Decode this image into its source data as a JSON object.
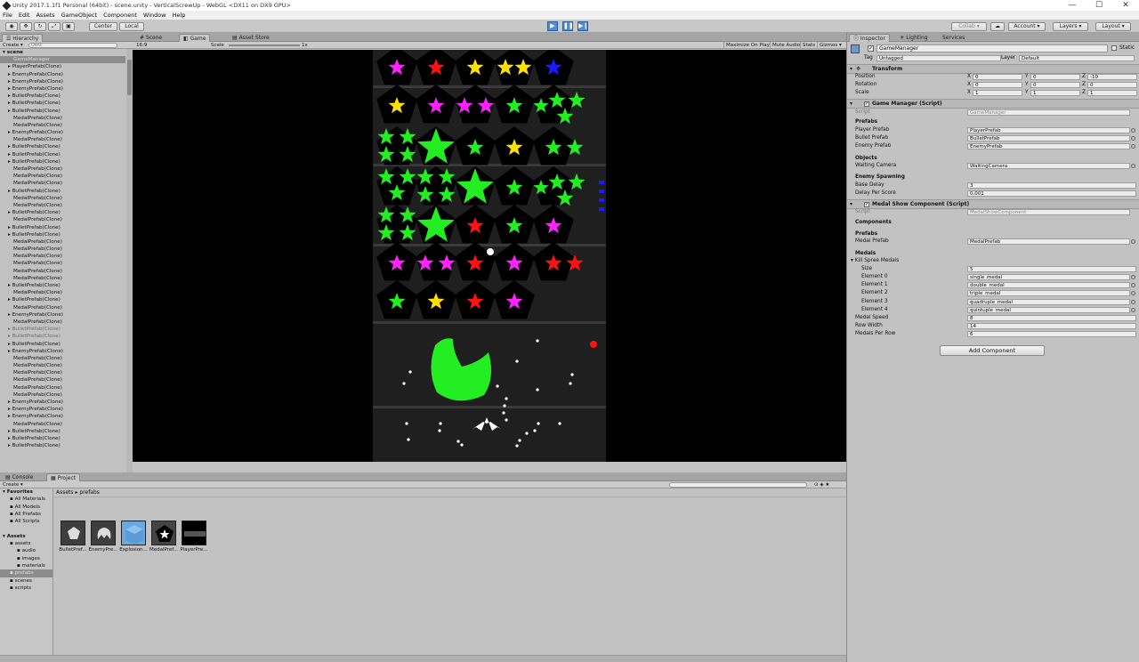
{
  "window": {
    "title": "Unity 2017.1.1f1 Personal (64bit) - scene.unity - VerticalScrewUp - WebGL <DX11 on DX9 GPU>",
    "minimize": "—",
    "maximize": "☐",
    "close": "✕"
  },
  "menu": [
    "File",
    "Edit",
    "Assets",
    "GameObject",
    "Component",
    "Window",
    "Help"
  ],
  "toolbar": {
    "pivot": "Center",
    "space": "Local",
    "collab": "Collab ▾",
    "account": "Account ▾",
    "layers": "Layers ▾",
    "layout": "Layout ▾"
  },
  "hierarchy": {
    "tab": "Hierarchy",
    "create": "Create ▾",
    "search_placeholder": "Q▾All",
    "scene": "scene",
    "items": [
      {
        "label": "GameManager",
        "state": "sel"
      },
      {
        "label": "PlayerPrefab(Clone)",
        "state": "arrow"
      },
      {
        "label": "EnemyPrefab(Clone)",
        "state": "arrow"
      },
      {
        "label": "EnemyPrefab(Clone)",
        "state": "arrow"
      },
      {
        "label": "EnemyPrefab(Clone)",
        "state": "arrow"
      },
      {
        "label": "BulletPrefab(Clone)",
        "state": "arrow"
      },
      {
        "label": "BulletPrefab(Clone)",
        "state": "arrow"
      },
      {
        "label": "BulletPrefab(Clone)",
        "state": "arrow"
      },
      {
        "label": "MedalPrefab(Clone)",
        "state": ""
      },
      {
        "label": "MedalPrefab(Clone)",
        "state": ""
      },
      {
        "label": "EnemyPrefab(Clone)",
        "state": "arrow"
      },
      {
        "label": "MedalPrefab(Clone)",
        "state": ""
      },
      {
        "label": "BulletPrefab(Clone)",
        "state": "arrow"
      },
      {
        "label": "BulletPrefab(Clone)",
        "state": "arrow"
      },
      {
        "label": "BulletPrefab(Clone)",
        "state": "arrow"
      },
      {
        "label": "MedalPrefab(Clone)",
        "state": ""
      },
      {
        "label": "MedalPrefab(Clone)",
        "state": ""
      },
      {
        "label": "MedalPrefab(Clone)",
        "state": ""
      },
      {
        "label": "BulletPrefab(Clone)",
        "state": "arrow"
      },
      {
        "label": "MedalPrefab(Clone)",
        "state": ""
      },
      {
        "label": "MedalPrefab(Clone)",
        "state": ""
      },
      {
        "label": "BulletPrefab(Clone)",
        "state": "arrow"
      },
      {
        "label": "MedalPrefab(Clone)",
        "state": ""
      },
      {
        "label": "BulletPrefab(Clone)",
        "state": "arrow"
      },
      {
        "label": "BulletPrefab(Clone)",
        "state": "arrow"
      },
      {
        "label": "MedalPrefab(Clone)",
        "state": ""
      },
      {
        "label": "MedalPrefab(Clone)",
        "state": ""
      },
      {
        "label": "MedalPrefab(Clone)",
        "state": ""
      },
      {
        "label": "MedalPrefab(Clone)",
        "state": ""
      },
      {
        "label": "MedalPrefab(Clone)",
        "state": ""
      },
      {
        "label": "MedalPrefab(Clone)",
        "state": ""
      },
      {
        "label": "BulletPrefab(Clone)",
        "state": "arrow"
      },
      {
        "label": "MedalPrefab(Clone)",
        "state": ""
      },
      {
        "label": "BulletPrefab(Clone)",
        "state": "arrow"
      },
      {
        "label": "MedalPrefab(Clone)",
        "state": ""
      },
      {
        "label": "EnemyPrefab(Clone)",
        "state": "arrow"
      },
      {
        "label": "MedalPrefab(Clone)",
        "state": ""
      },
      {
        "label": "BulletPrefab(Clone)",
        "state": "dim"
      },
      {
        "label": "BulletPrefab(Clone)",
        "state": "dim"
      },
      {
        "label": "BulletPrefab(Clone)",
        "state": "arrow"
      },
      {
        "label": "EnemyPrefab(Clone)",
        "state": "arrow"
      },
      {
        "label": "MedalPrefab(Clone)",
        "state": ""
      },
      {
        "label": "MedalPrefab(Clone)",
        "state": ""
      },
      {
        "label": "MedalPrefab(Clone)",
        "state": ""
      },
      {
        "label": "MedalPrefab(Clone)",
        "state": ""
      },
      {
        "label": "MedalPrefab(Clone)",
        "state": ""
      },
      {
        "label": "MedalPrefab(Clone)",
        "state": ""
      },
      {
        "label": "EnemyPrefab(Clone)",
        "state": "arrow"
      },
      {
        "label": "EnemyPrefab(Clone)",
        "state": "arrow"
      },
      {
        "label": "EnemyPrefab(Clone)",
        "state": "arrow"
      },
      {
        "label": "MedalPrefab(Clone)",
        "state": ""
      },
      {
        "label": "BulletPrefab(Clone)",
        "state": "arrow"
      },
      {
        "label": "BulletPrefab(Clone)",
        "state": "arrow"
      },
      {
        "label": "BulletPrefab(Clone)",
        "state": "arrow"
      }
    ]
  },
  "game": {
    "tabs": [
      "Scene",
      "Game",
      "Asset Store"
    ],
    "aspect": "16:9",
    "scale_label": "Scale",
    "scale_value": "1x",
    "options": [
      "Maximize On Play",
      "Mute Audio",
      "Stats",
      "Gizmos ▾"
    ]
  },
  "inspector": {
    "tabs": [
      "Inspector",
      "Lighting",
      "Services"
    ],
    "object_name": "GameManager",
    "static_label": "Static",
    "tag_label": "Tag",
    "tag_value": "Untagged",
    "layer_label": "Layer",
    "layer_value": "Default",
    "transform": {
      "title": "Transform",
      "position": {
        "label": "Position",
        "x": "0",
        "y": "0",
        "z": "-10"
      },
      "rotation": {
        "label": "Rotation",
        "x": "0",
        "y": "0",
        "z": "0"
      },
      "scale": {
        "label": "Scale",
        "x": "1",
        "y": "1",
        "z": "1"
      }
    },
    "game_manager": {
      "title": "Game Manager (Script)",
      "script_label": "Script",
      "script_value": "GameManager",
      "prefabs_hdr": "Prefabs",
      "player_prefab_label": "Player Prefab",
      "player_prefab_value": "PlayerPrefab",
      "bullet_prefab_label": "Bullet Prefab",
      "bullet_prefab_value": "BulletPrefab",
      "enemy_prefab_label": "Enemy Prefab",
      "enemy_prefab_value": "EnemyPrefab",
      "objects_hdr": "Objects",
      "waiting_camera_label": "Waiting Camera",
      "waiting_camera_value": "WaitingCamera",
      "spawning_hdr": "Enemy Spawning",
      "base_delay_label": "Base Delay",
      "base_delay_value": "3",
      "delay_per_score_label": "Delay Per Score",
      "delay_per_score_value": "0.001"
    },
    "medal_show": {
      "title": "Medal Show Component (Script)",
      "script_label": "Script",
      "script_value": "MedalShowComponent",
      "components_hdr": "Components",
      "prefabs_hdr": "Prefabs",
      "medal_prefab_label": "Medal Prefab",
      "medal_prefab_value": "MedalPrefab",
      "medals_hdr": "Medals",
      "kill_spree_label": "Kill Spree Medals",
      "size_label": "Size",
      "size_value": "5",
      "elements": [
        {
          "label": "Element 0",
          "value": "single_medal"
        },
        {
          "label": "Element 1",
          "value": "double_medal"
        },
        {
          "label": "Element 2",
          "value": "triple_medal"
        },
        {
          "label": "Element 3",
          "value": "quadruple_medal"
        },
        {
          "label": "Element 4",
          "value": "quintuple_medal"
        }
      ],
      "medal_speed_label": "Medal Speed",
      "medal_speed_value": "8",
      "row_width_label": "Row Width",
      "row_width_value": "14",
      "medals_per_row_label": "Medals Per Row",
      "medals_per_row_value": "6"
    },
    "add_component": "Add Component"
  },
  "bottom": {
    "tabs": [
      "Console",
      "Project"
    ],
    "create": "Create ▾",
    "breadcrumb": [
      "Assets",
      "prefabs"
    ],
    "tree": [
      {
        "label": "Favorites",
        "level": 0,
        "bold": true
      },
      {
        "label": "All Materials",
        "level": 1
      },
      {
        "label": "All Models",
        "level": 1
      },
      {
        "label": "All Prefabs",
        "level": 1
      },
      {
        "label": "All Scripts",
        "level": 1
      },
      {
        "label": "",
        "level": 0
      },
      {
        "label": "Assets",
        "level": 0,
        "bold": true
      },
      {
        "label": "assets",
        "level": 1
      },
      {
        "label": "audio",
        "level": 2
      },
      {
        "label": "images",
        "level": 2
      },
      {
        "label": "materials",
        "level": 2
      },
      {
        "label": "prefabs",
        "level": 1,
        "sel": true
      },
      {
        "label": "scenes",
        "level": 1
      },
      {
        "label": "scripts",
        "level": 1
      }
    ],
    "assets": [
      "BulletPref...",
      "EnemyPre...",
      "Explosion...",
      "MedalPref...",
      "PlayerPre..."
    ]
  }
}
